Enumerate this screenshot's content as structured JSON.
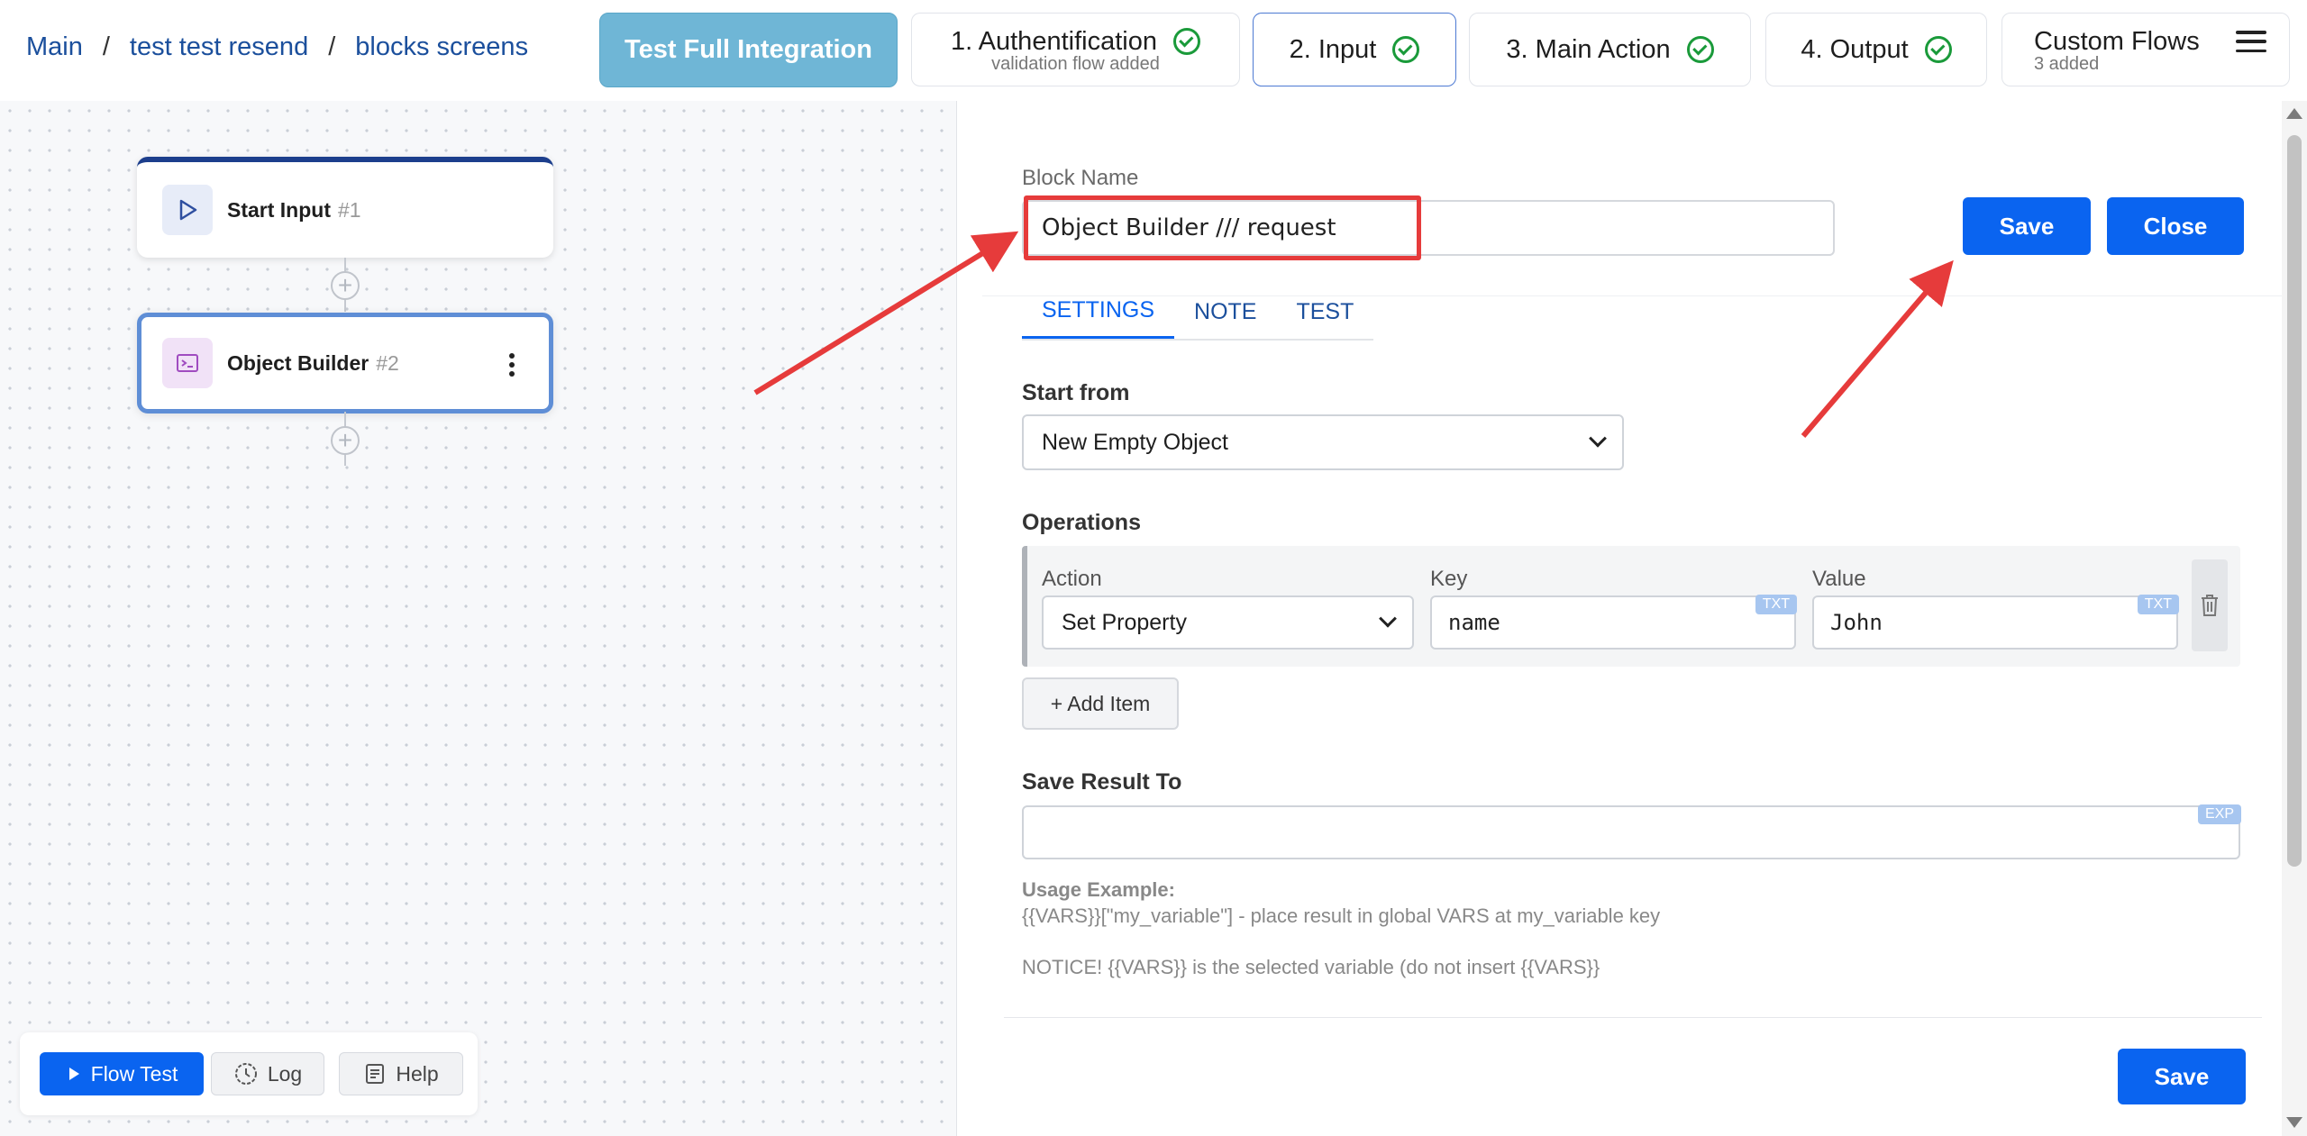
{
  "breadcrumb": {
    "items": [
      "Main",
      "test test resend",
      "blocks screens"
    ],
    "separator": "/"
  },
  "steps": {
    "test_full": "Test Full Integration",
    "auth": {
      "label": "1. Authentification",
      "sub": "validation flow added"
    },
    "input": {
      "label": "2. Input"
    },
    "main_action": {
      "label": "3. Main Action"
    },
    "output": {
      "label": "4. Output"
    },
    "custom_flows": {
      "label": "Custom Flows",
      "sub": "3 added"
    }
  },
  "canvas": {
    "nodes": [
      {
        "title": "Start Input",
        "num": "#1",
        "icon": "play-icon"
      },
      {
        "title": "Object Builder",
        "num": "#2",
        "icon": "terminal-icon"
      }
    ],
    "toolbar": {
      "flow_test": "Flow Test",
      "log": "Log",
      "help": "Help"
    }
  },
  "panel": {
    "block_name_label": "Block Name",
    "block_name_value": "Object Builder /// request",
    "save": "Save",
    "close": "Close",
    "tabs": [
      "SETTINGS",
      "NOTE",
      "TEST"
    ],
    "active_tab": "SETTINGS",
    "start_from_label": "Start from",
    "start_from_value": "New Empty Object",
    "operations_label": "Operations",
    "operation": {
      "action_label": "Action",
      "action_value": "Set Property",
      "key_label": "Key",
      "key_value": "name",
      "key_tag": "TXT",
      "value_label": "Value",
      "value_value": "John",
      "value_tag": "TXT"
    },
    "add_item": "+ Add Item",
    "save_result_label": "Save Result To",
    "save_result_tag": "EXP",
    "usage_title": "Usage Example:",
    "usage_text": "{{VARS}}[\"my_variable\"] - place result in global VARS at my_variable key",
    "notice_text": "NOTICE! {{VARS}} is the selected variable (do not insert {{VARS}}",
    "save_bottom": "Save"
  },
  "colors": {
    "primary": "#0a64f0",
    "test_full_bg": "#6fb6d6",
    "check_green": "#1a9a3a",
    "annotation_red": "#e63b3b",
    "link_blue": "#1b4f9c"
  }
}
